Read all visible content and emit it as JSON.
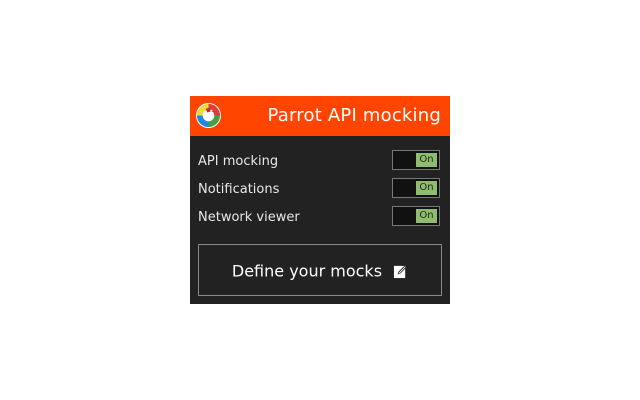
{
  "header": {
    "title": "Parrot API mocking",
    "logo_icon": "parrot-logo-icon",
    "background_color": "#ff4500"
  },
  "settings": [
    {
      "label": "API mocking",
      "state": "On"
    },
    {
      "label": "Notifications",
      "state": "On"
    },
    {
      "label": "Network viewer",
      "state": "On"
    }
  ],
  "toggle_on_color": "#8fbc6f",
  "define_button": {
    "label": "Define your mocks",
    "icon": "edit-icon"
  }
}
